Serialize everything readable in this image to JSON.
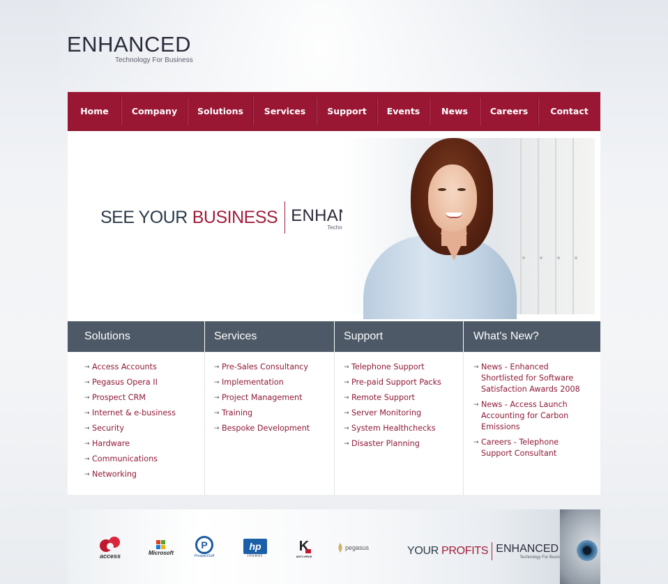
{
  "brand": {
    "name": "ENHANCED",
    "tagline": "Technology For Business",
    "accent": "#9a1734",
    "dark": "#4d5966"
  },
  "nav": {
    "items": [
      "Home",
      "Company",
      "Solutions",
      "Services",
      "Support",
      "Events",
      "News",
      "Careers",
      "Contact"
    ]
  },
  "hero": {
    "see": "SEE YOUR",
    "business": "BUSINESS",
    "logo": "ENHANCED",
    "tagline": "Technology For Business"
  },
  "sections": {
    "solutions": {
      "title": "Solutions",
      "items": [
        "Access Accounts",
        "Pegasus Opera II",
        "Prospect CRM",
        "Internet & e-business",
        "Security",
        "Hardware",
        "Communications",
        "Networking"
      ]
    },
    "services": {
      "title": "Services",
      "items": [
        "Pre-Sales Consultancy",
        "Implementation",
        "Project Management",
        "Training",
        "Bespoke Development"
      ]
    },
    "support": {
      "title": "Support",
      "items": [
        "Telephone Support",
        "Pre-paid Support Packs",
        "Remote Support",
        "Server Monitoring",
        "System Healthchecks",
        "Disaster Planning"
      ]
    },
    "whats_new": {
      "title": "What's New?",
      "items": [
        "News - Enhanced Shortlisted for Software Satisfaction Awards 2008",
        "News - Access Launch Accounting for Carbon Emissions",
        "Careers - Telephone Support Consultant"
      ]
    }
  },
  "partners": {
    "access": "access",
    "microsoft": "Microsoft",
    "prospect": "P",
    "prospect_sub": "ProspectSoft",
    "hp": "hp",
    "hp_sub": "invent",
    "kaspersky": "K",
    "kaspersky_sub": "ANTI-VIRUS",
    "pegasus": "pegasus"
  },
  "footer": {
    "your": "YOUR",
    "profits": "PROFITS",
    "logo": "ENHANCED",
    "tagline": "Technology For Business"
  }
}
